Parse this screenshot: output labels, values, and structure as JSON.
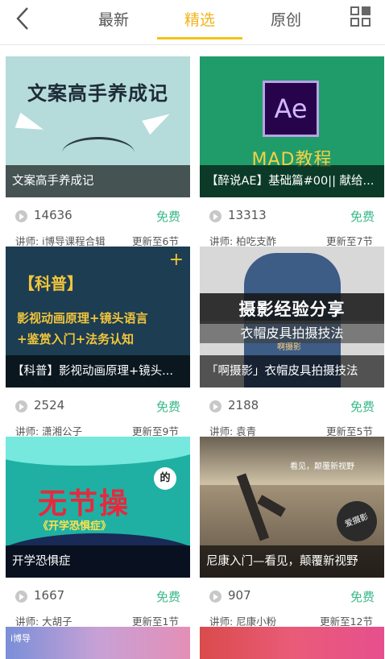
{
  "header": {
    "tabs": [
      {
        "label": "最新",
        "active": false
      },
      {
        "label": "精选",
        "active": true
      },
      {
        "label": "原创",
        "active": false
      }
    ]
  },
  "colors": {
    "accent": "#f5c214",
    "free": "#3ab889"
  },
  "courses": [
    {
      "caption": "文案高手养成记",
      "thumb_text": {
        "title": "文案高手养成记"
      },
      "views": "14636",
      "price": "免费",
      "lecturer": "讲师: i博导课程合辑",
      "update": "更新至6节"
    },
    {
      "caption": "【醉说AE】基础篇#00|| 献给...",
      "thumb_text": {
        "logo": "Ae",
        "banner": "MAD教程"
      },
      "views": "13313",
      "price": "免费",
      "lecturer": "讲师: 柏吃支酢",
      "update": "更新至7节"
    },
    {
      "caption": "【科普】影视动画原理+镜头...",
      "thumb_text": {
        "head": "【科普】",
        "line1": "影视动画原理+镜头语言",
        "line2": "+鉴赏入门+法务认知",
        "plus": "+"
      },
      "views": "2524",
      "price": "免费",
      "lecturer": "讲师: 潇湘公子",
      "update": "更新至9节"
    },
    {
      "caption": "「啊摄影」衣帽皮具拍摄技法",
      "thumb_text": {
        "big": "摄影经验分享",
        "small": "衣帽皮具拍摄技法",
        "tag": "啊摄影"
      },
      "views": "2188",
      "price": "免费",
      "lecturer": "讲师: 袁青",
      "update": "更新至5节"
    },
    {
      "caption": "开学恐惧症",
      "thumb_text": {
        "big": "无节操",
        "sub": "《开学恐惧症》",
        "badge": "的"
      },
      "views": "1667",
      "price": "免费",
      "lecturer": "讲师: 大胡子",
      "update": "更新至1节"
    },
    {
      "caption": "尼康入门—看见，颠覆新视野",
      "thumb_text": {
        "tag": "看见，颠覆新视野",
        "logo": "爱摄影"
      },
      "views": "907",
      "price": "免费",
      "lecturer": "讲师: 尼康小粉",
      "update": "更新至12节"
    }
  ],
  "partial_cards": [
    {
      "brand": "i博导"
    },
    {
      "brand": ""
    }
  ]
}
